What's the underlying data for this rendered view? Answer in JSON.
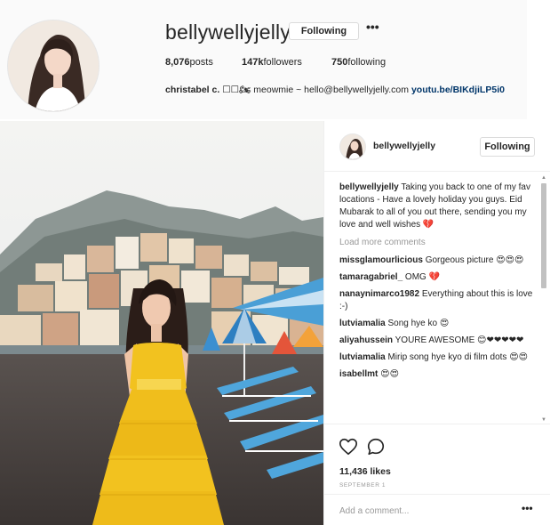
{
  "profile": {
    "username": "bellywellyjelly",
    "follow_button": "Following",
    "more_label": "•••",
    "stats": {
      "posts": "8,076",
      "posts_label": " posts",
      "followers": "147k",
      "followers_label": " followers",
      "following": "750",
      "following_label": " following"
    },
    "bio": {
      "name": "christabel c.",
      "emoji": "☐☐🏍",
      "text": " meowmie ~ hello@bellywellyjelly.com ",
      "link": "youtu.be/BIKdjiLP5i0"
    }
  },
  "post": {
    "username": "bellywellyjelly",
    "follow_button": "Following",
    "caption_user": "bellywellyjelly",
    "caption_text": " Taking you back to one of my fav locations - Have a lovely holiday you guys. Eid Mubarak to all of you out there, sending you my love and well wishes 💔",
    "load_more": "Load more comments",
    "comments": [
      {
        "user": "missglamourlicious",
        "text": " Gorgeous picture 😍😍😍"
      },
      {
        "user": "tamaragabriel_",
        "text": " OMG 💔"
      },
      {
        "user": "nanaynimarco1982",
        "text": " Everything about this is love :-)"
      },
      {
        "user": "lutviamalia",
        "text": " Song hye ko 😍"
      },
      {
        "user": "aliyahussein",
        "text": " YOURE AWESOME 😊❤❤❤❤❤"
      },
      {
        "user": "lutviamalia",
        "text": " Mirip song hye kyo di film dots 😍😍"
      },
      {
        "user": "isabellmt",
        "text": " 😍😍"
      }
    ],
    "likes": "11,436 likes",
    "date": "SEPTEMBER 1",
    "comment_placeholder": "Add a comment...",
    "more_label": "•••",
    "icons": {
      "like": "heart-icon",
      "comment": "comment-icon"
    }
  },
  "colors": {
    "link": "#003569",
    "muted": "#999999",
    "border": "#efefef",
    "dress": "#f2c21f"
  }
}
